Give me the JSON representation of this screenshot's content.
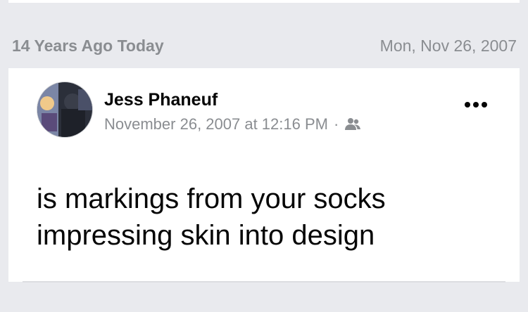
{
  "memory": {
    "title": "14 Years Ago Today",
    "date": "Mon, Nov 26, 2007"
  },
  "post": {
    "author": "Jess Phaneuf",
    "timestamp": "November 26, 2007 at 12:16 PM",
    "separator": "·",
    "audience_icon": "friends-icon",
    "more_icon": "more-options-icon",
    "text": "is markings from your socks impressing skin into design"
  },
  "colors": {
    "background": "#e9eaee",
    "card": "#ffffff",
    "secondary_text": "#8a8d91",
    "primary_text": "#050505"
  }
}
